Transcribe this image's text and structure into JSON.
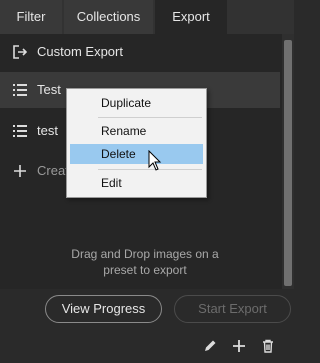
{
  "tabs": [
    {
      "label": "Filter"
    },
    {
      "label": "Collections"
    },
    {
      "label": "Export",
      "active": true
    }
  ],
  "presets": [
    {
      "label": "Custom Export",
      "icon": "export-icon"
    },
    {
      "label": "Test",
      "icon": "list-icon"
    },
    {
      "label": "test",
      "icon": "list-icon"
    },
    {
      "label": "Creat",
      "icon": "plus-icon"
    }
  ],
  "hint": {
    "line1": "Drag and Drop images on a",
    "line2": "preset to export"
  },
  "buttons": {
    "view_progress": "View Progress",
    "start_export": "Start Export"
  },
  "context_menu": {
    "items": [
      "Duplicate",
      "Rename",
      "Delete",
      "Edit"
    ],
    "highlighted": "Delete"
  },
  "toolbar_icons": [
    "pencil-icon",
    "plus-icon",
    "trash-icon"
  ],
  "colors": {
    "panel_bg": "#262626",
    "menu_bg": "#f2f2f2",
    "menu_highlight": "#99c9ef"
  }
}
